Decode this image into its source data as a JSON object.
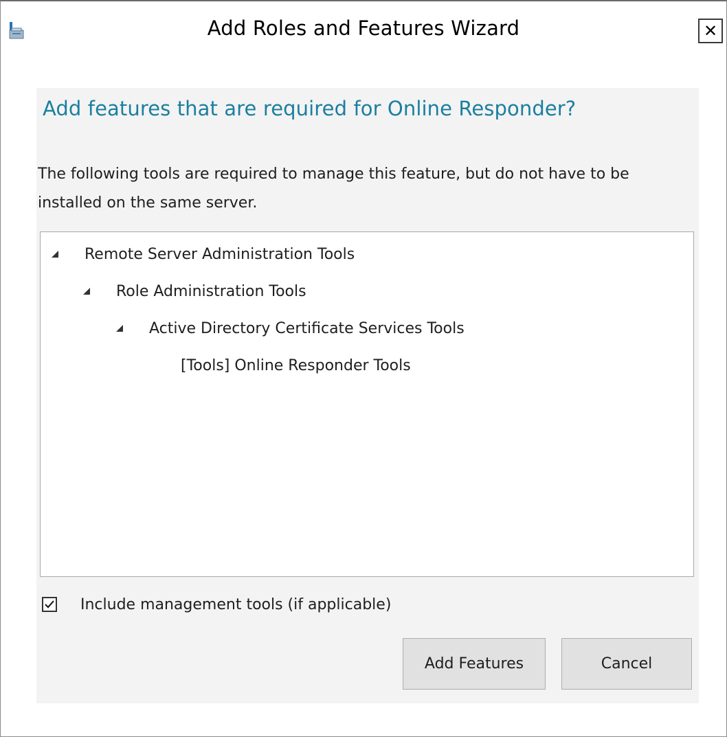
{
  "window": {
    "title": "Add Roles and Features Wizard",
    "close_glyph": "✕",
    "icon": "server-manager-icon"
  },
  "dialog": {
    "heading": "Add features that are required for Online Responder?",
    "description": "The following tools are required to manage this feature, but do not have to be installed on the same server.",
    "tree": [
      {
        "label": "Remote Server Administration Tools",
        "expanded": true,
        "level": 0
      },
      {
        "label": "Role Administration Tools",
        "expanded": true,
        "level": 1
      },
      {
        "label": "Active Directory Certificate Services Tools",
        "expanded": true,
        "level": 2
      },
      {
        "label": "[Tools] Online Responder Tools",
        "expanded": false,
        "level": 3
      }
    ],
    "include_tools": {
      "label": "Include management tools (if applicable)",
      "checked": true
    },
    "add_button": "Add Features",
    "cancel_button": "Cancel"
  },
  "colors": {
    "heading": "#1a7fa0",
    "panel_background": "#f3f3f3",
    "button_background": "#e1e1e1"
  }
}
